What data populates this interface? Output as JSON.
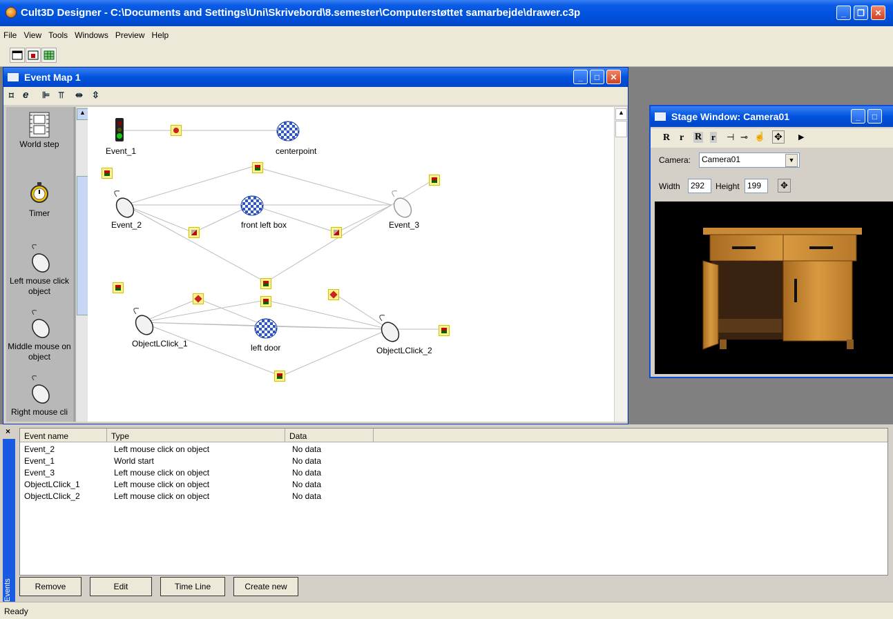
{
  "app": {
    "title": "Cult3D Designer - C:\\Documents and Settings\\Uni\\Skrivebord\\8.semester\\Computerstøttet samarbejde\\drawer.c3p"
  },
  "menu": [
    "File",
    "View",
    "Tools",
    "Windows",
    "Preview",
    "Help"
  ],
  "event_map": {
    "title": "Event Map 1",
    "toolbar_e": "e",
    "palette": [
      {
        "label": "World step",
        "icon": "film-strip-icon"
      },
      {
        "label": "Timer",
        "icon": "stopwatch-icon"
      },
      {
        "label": "Left mouse click object",
        "icon": "mouse-icon"
      },
      {
        "label": "Middle mouse on object",
        "icon": "mouse-icon"
      },
      {
        "label": "Right mouse cli",
        "icon": "mouse-icon"
      }
    ],
    "nodes": {
      "event_1": "Event_1",
      "centerpoint": "centerpoint",
      "event_2": "Event_2",
      "front_left_box": "front left box",
      "event_3": "Event_3",
      "objectlclick_1": "ObjectLClick_1",
      "left_door": "left door",
      "objectlclick_2": "ObjectLClick_2"
    }
  },
  "stage": {
    "title": "Stage Window: Camera01",
    "toolbar": [
      "R",
      "r",
      "R",
      "r"
    ],
    "camera_label": "Camera:",
    "camera_value": "Camera01",
    "width_label": "Width",
    "width_value": "292",
    "height_label": "Height",
    "height_value": "199"
  },
  "events_panel": {
    "tab_label": "Events",
    "columns": [
      "Event name",
      "Type",
      "Data"
    ],
    "rows": [
      {
        "name": "Event_2",
        "type": "Left mouse click on object",
        "data": "No data"
      },
      {
        "name": "Event_1",
        "type": "World start",
        "data": "No data"
      },
      {
        "name": "Event_3",
        "type": "Left mouse click on object",
        "data": "No data"
      },
      {
        "name": "ObjectLClick_1",
        "type": "Left mouse click on object",
        "data": "No data"
      },
      {
        "name": "ObjectLClick_2",
        "type": "Left mouse click on object",
        "data": "No data"
      }
    ],
    "buttons": {
      "remove": "Remove",
      "edit": "Edit",
      "timeline": "Time Line",
      "create": "Create new"
    },
    "close_glyph": "×"
  },
  "status": "Ready",
  "colors": {
    "titlebar": "#0052dd",
    "canvas": "#ffffff",
    "palette": "#b8b8b8",
    "viewport": "#000000"
  }
}
